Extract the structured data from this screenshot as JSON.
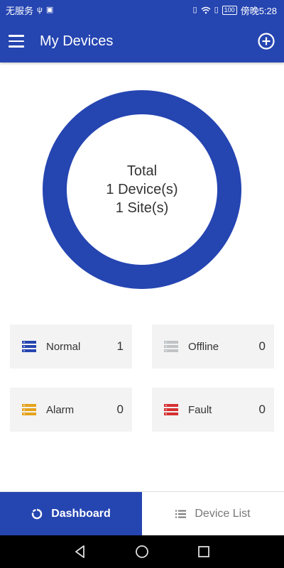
{
  "status_bar": {
    "left_text": "无服务",
    "battery": "100",
    "time": "傍晚5:28"
  },
  "app_bar": {
    "title": "My Devices",
    "menu_icon": "hamburger-menu-icon",
    "add_icon": "add-circle-icon"
  },
  "summary": {
    "line1": "Total",
    "line2": "1 Device(s)",
    "line3": "1 Site(s)",
    "ring_color": "#2545b1"
  },
  "cards": {
    "normal": {
      "label": "Normal",
      "count": "1",
      "color": "#2545b1"
    },
    "offline": {
      "label": "Offline",
      "count": "0",
      "color": "#bfc3c6"
    },
    "alarm": {
      "label": "Alarm",
      "count": "0",
      "color": "#e5a21c"
    },
    "fault": {
      "label": "Fault",
      "count": "0",
      "color": "#d63031"
    }
  },
  "tabs": {
    "dashboard": "Dashboard",
    "device_list": "Device List"
  },
  "colors": {
    "primary": "#2545b1",
    "card_bg": "#f2f3f2"
  }
}
